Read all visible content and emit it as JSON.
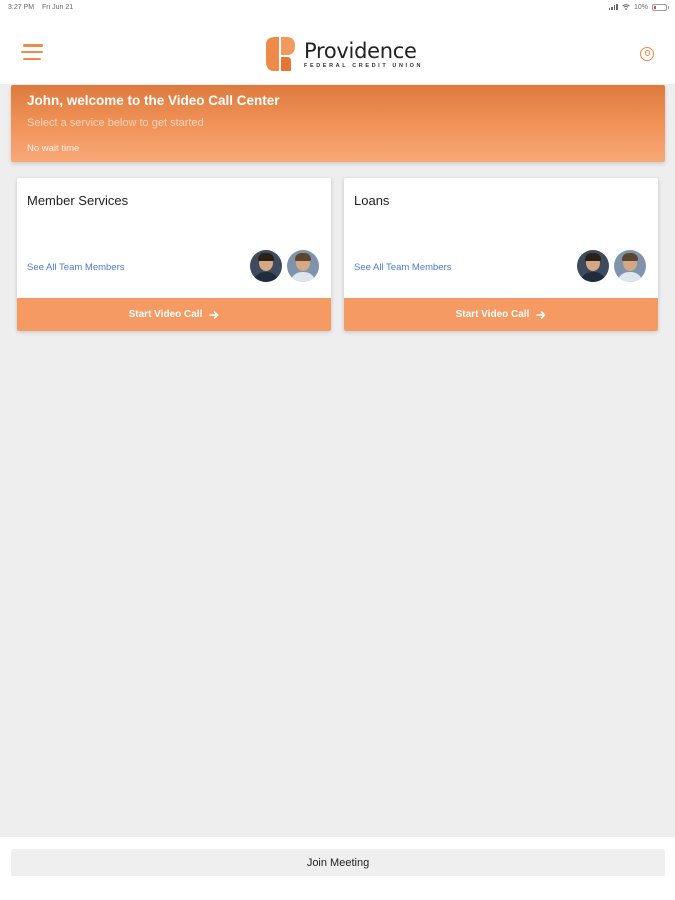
{
  "status_bar": {
    "time": "3:27 PM",
    "date": "Fri Jun 21",
    "battery": "10%"
  },
  "header": {
    "brand_name": "Providence",
    "brand_subtitle": "FEDERAL CREDIT UNION",
    "accent_color": "#f08a4b"
  },
  "welcome": {
    "title": "John, welcome to the Video Call Center",
    "subtitle": "Select a service below to get started",
    "wait_time": "No wait time"
  },
  "services": [
    {
      "title": "Member Services",
      "team_link": "See All Team Members",
      "button_label": "Start Video Call"
    },
    {
      "title": "Loans",
      "team_link": "See All Team Members",
      "button_label": "Start Video Call"
    }
  ],
  "footer": {
    "join_label": "Join Meeting"
  },
  "colors": {
    "banner": "#f2945a",
    "button": "#f59a63",
    "link": "#4a7bd3",
    "background": "#efeeee"
  }
}
